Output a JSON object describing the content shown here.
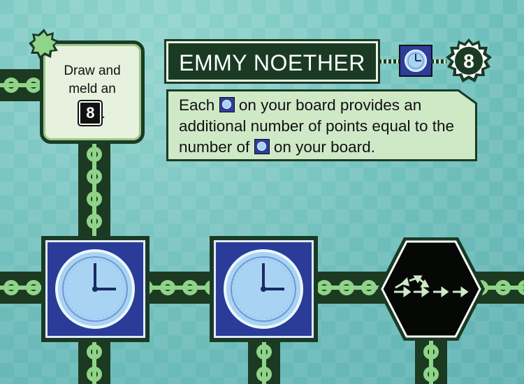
{
  "colors": {
    "background": "#7fcbc4",
    "frame_dark_green": "#1a3a24",
    "panel_light_green": "#cfe9c7",
    "gear_green": "#8fd489",
    "clock_blue": "#2a3b98",
    "clock_face": "#a9d3f2"
  },
  "clue_card": {
    "line1": "Draw and",
    "line2": "meld an",
    "age_value": "8",
    "trailing": ".",
    "star_icon": "star-icon"
  },
  "card": {
    "title": "EMMY NOETHER",
    "featured_icon": "clock-icon",
    "age": "8"
  },
  "dogma": {
    "part1": "Each",
    "icon1": "clock-icon",
    "part2": "on your board provides an additional number of points equal to the number of",
    "icon2": "clock-icon",
    "part3": "on your board."
  },
  "icons": {
    "tile1": "clock-icon",
    "tile2": "clock-icon",
    "tile3": "hex-arrows-icon"
  }
}
